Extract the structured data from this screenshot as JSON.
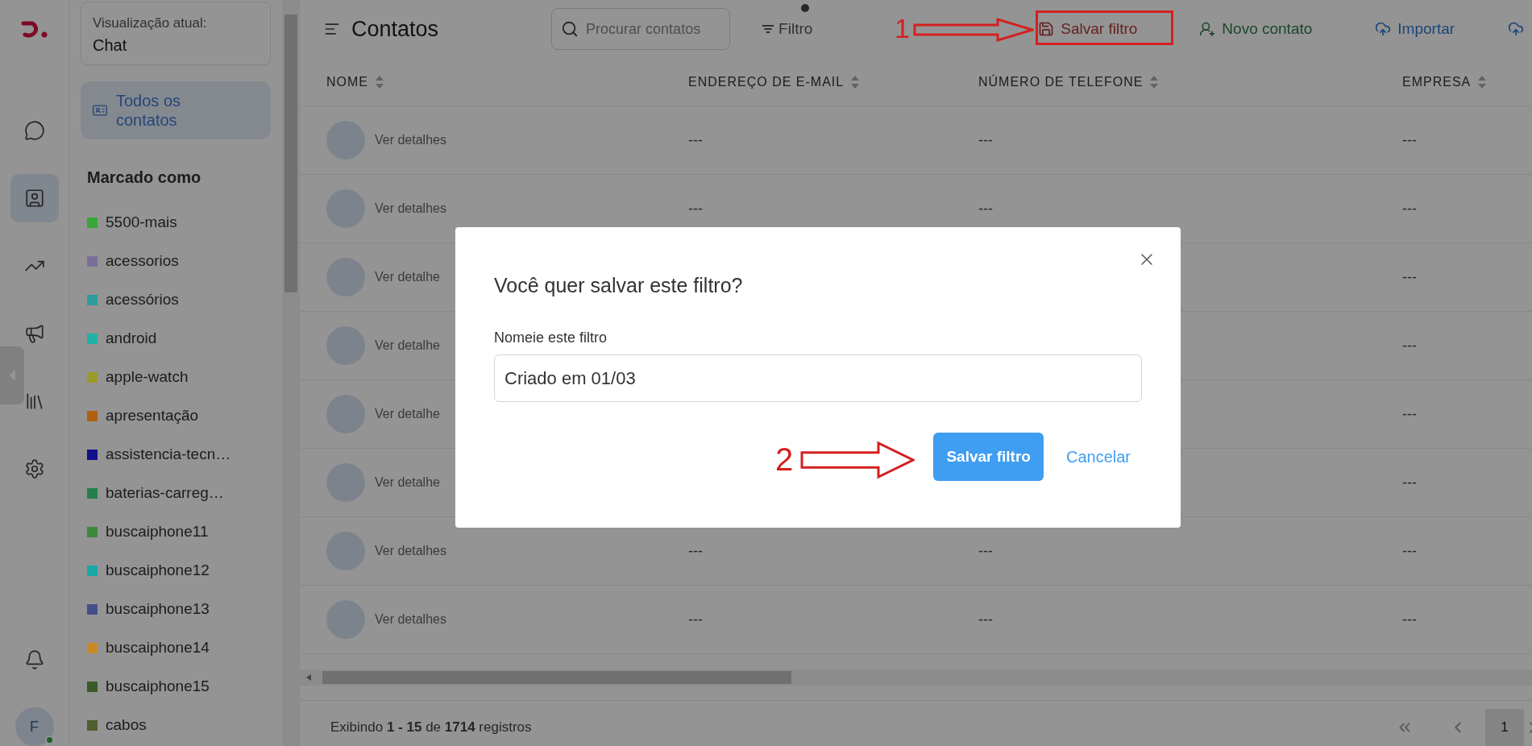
{
  "rail": {
    "items": [
      {
        "selected": false
      },
      {
        "selected": true
      },
      {
        "selected": false
      },
      {
        "selected": false
      },
      {
        "selected": false
      },
      {
        "selected": false
      }
    ],
    "avatar": {
      "initial": "F",
      "online": true
    }
  },
  "sidebar": {
    "current_view": {
      "label": "Visualização atual:",
      "value": "Chat"
    },
    "all_contacts": {
      "label": "Todos os contatos",
      "selected": true
    },
    "tags_heading": "Marcado como",
    "tags": [
      {
        "name": "5500-mais",
        "color": "#35a835"
      },
      {
        "name": "acessorios",
        "color": "#7a6f9a"
      },
      {
        "name": "acessórios",
        "color": "#2e9c9c"
      },
      {
        "name": "android",
        "color": "#20b0a4"
      },
      {
        "name": "apple-watch",
        "color": "#9a9a2a"
      },
      {
        "name": "apresentação",
        "color": "#b0600c"
      },
      {
        "name": "assistencia-tecn…",
        "color": "#10108a"
      },
      {
        "name": "baterias-carreg…",
        "color": "#24804a"
      },
      {
        "name": "buscaiphone11",
        "color": "#3c8a3c"
      },
      {
        "name": "buscaiphone12",
        "color": "#18a8a8"
      },
      {
        "name": "buscaiphone13",
        "color": "#44508a"
      },
      {
        "name": "buscaiphone14",
        "color": "#c88a28"
      },
      {
        "name": "buscaiphone15",
        "color": "#3a5a28"
      },
      {
        "name": "cabos",
        "color": "#505e30"
      }
    ]
  },
  "header": {
    "title": "Contatos",
    "search": {
      "placeholder": "Procurar contatos"
    },
    "filter": {
      "label": "Filtro",
      "indicator": true
    },
    "actions": [
      {
        "kind": "save",
        "label": "Salvar filtro"
      },
      {
        "kind": "new",
        "label": "Novo contato"
      },
      {
        "kind": "import",
        "label": "Importar"
      },
      {
        "kind": "cloud"
      }
    ]
  },
  "table": {
    "columns": [
      {
        "label": "NOME"
      },
      {
        "label": "ENDEREÇO DE E-MAIL"
      },
      {
        "label": "NÚMERO DE TELEFONE"
      },
      {
        "label": "EMPRESA"
      }
    ],
    "rows": [
      {
        "name": "Ver detalhes",
        "email": "---",
        "phone": "---",
        "company": "---"
      },
      {
        "name": "Ver detalhes",
        "email": "---",
        "phone": "---",
        "company": "---"
      },
      {
        "name": "Ver detalhe",
        "company": "---"
      },
      {
        "name": "Ver detalhe",
        "company": "---"
      },
      {
        "name": "Ver detalhe",
        "company": "---"
      },
      {
        "name": "Ver detalhe",
        "company": "---"
      },
      {
        "name": "Ver detalhes",
        "email": "---",
        "phone": "---",
        "company": "---"
      },
      {
        "name": "Ver detalhes",
        "email": "---",
        "phone": "---",
        "company": "---"
      }
    ]
  },
  "footer": {
    "summary": "Exibindo **1 - 15** de **1714** registros",
    "pages": [
      {
        "label": "1",
        "selected": true
      }
    ]
  },
  "dialog": {
    "title": "Você quer salvar este filtro?",
    "field_label": "Nomeie este filtro",
    "value": "Criado em 01/03",
    "buttons": [
      {
        "kind": "primary",
        "label": "Salvar filtro"
      },
      {
        "kind": "link",
        "label": "Cancelar"
      }
    ]
  },
  "annotations": [
    {
      "label": "1"
    },
    {
      "label": "2"
    }
  ]
}
